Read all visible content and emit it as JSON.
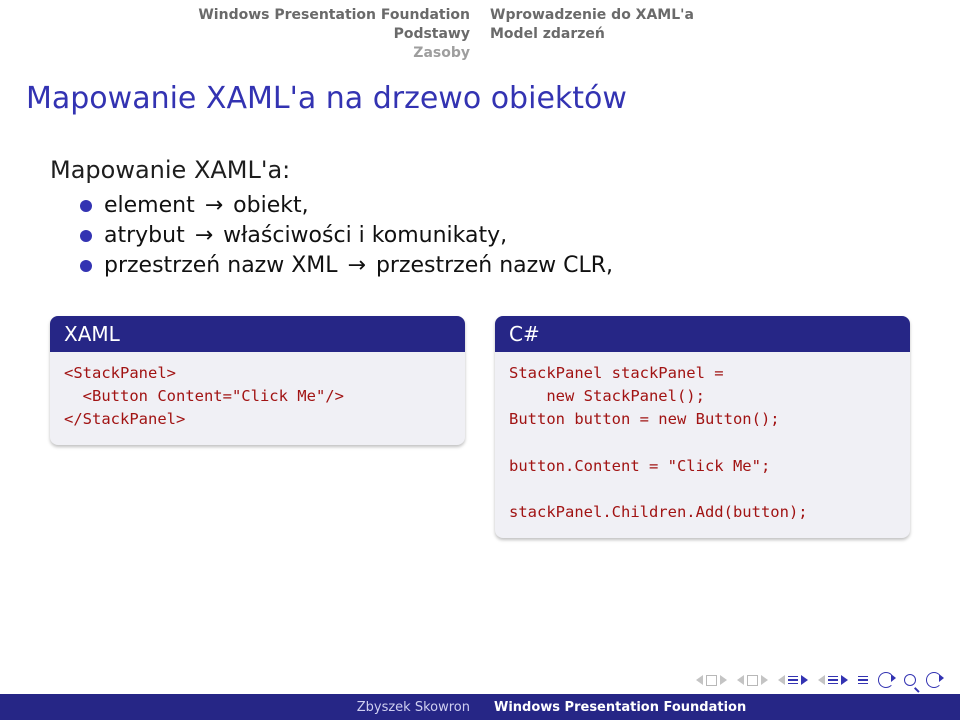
{
  "header": {
    "left": [
      "Windows Presentation Foundation",
      "Podstawy",
      "Zasoby"
    ],
    "right": [
      "Wprowadzenie do XAML'a",
      "Model zdarzeń"
    ]
  },
  "title": "Mapowanie XAML'a na drzewo obiektów",
  "subtitle": "Mapowanie XAML'a:",
  "bullets": [
    {
      "a": "element",
      "b": "obiekt,"
    },
    {
      "a": "atrybut",
      "b": "właściwości i komunikaty,"
    },
    {
      "a": "przestrzeń nazw XML",
      "b": "przestrzeń nazw CLR,"
    }
  ],
  "blocks": {
    "xaml": {
      "title": "XAML",
      "code": "<StackPanel>\n  <Button Content=\"Click Me\"/>\n</StackPanel>"
    },
    "csharp": {
      "title": "C#",
      "code": "StackPanel stackPanel =\n    new StackPanel();\nButton button = new Button();\n\nbutton.Content = \"Click Me\";\n\nstackPanel.Children.Add(button);"
    }
  },
  "footer": {
    "author": "Zbyszek Skowron",
    "talk": "Windows Presentation Foundation"
  }
}
